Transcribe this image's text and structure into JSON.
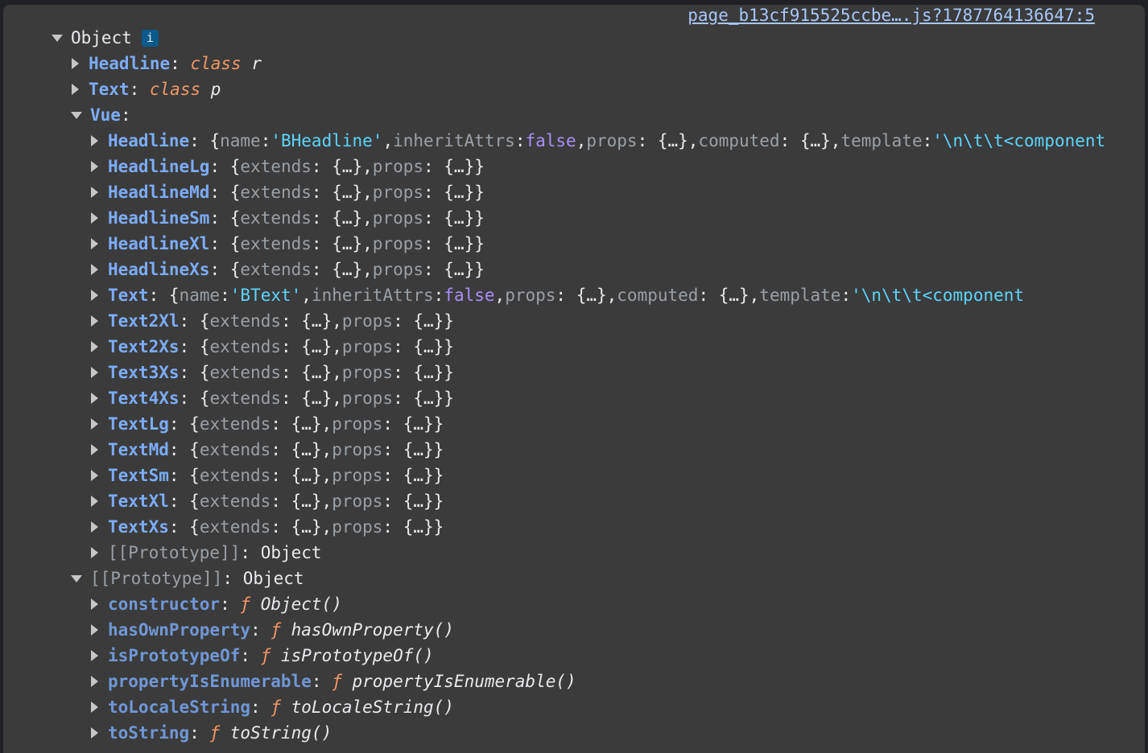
{
  "source_link": "page_b13cf915525ccbe….js?1787764136647:5",
  "root": {
    "label": "Object",
    "info_label": "i"
  },
  "colors": {
    "background": "#3b3b3b",
    "key": "#7cacf8",
    "string": "#5cd5fb",
    "boolean": "#a98ef7",
    "keyword": "#f29766",
    "muted": "#9aa0a6",
    "link": "#a8c7fa"
  },
  "icons": {
    "collapsed": "triangle-right-icon",
    "expanded": "triangle-down-icon",
    "info": "info-icon"
  },
  "rows": [
    {
      "depth": 1,
      "expanded": false,
      "key": "Headline",
      "kind": "class",
      "kw": "class",
      "name": "r"
    },
    {
      "depth": 1,
      "expanded": false,
      "key": "Text",
      "kind": "class",
      "kw": "class",
      "name": "p"
    },
    {
      "depth": 1,
      "expanded": true,
      "key": "Vue",
      "kind": "empty"
    },
    {
      "depth": 2,
      "expanded": false,
      "key": "Headline",
      "kind": "object",
      "parts": [
        {
          "t": "plain",
          "v": "{"
        },
        {
          "t": "pk",
          "v": "name"
        },
        {
          "t": "plain",
          "v": ": "
        },
        {
          "t": "str",
          "v": "'BHeadline'"
        },
        {
          "t": "plain",
          "v": ", "
        },
        {
          "t": "pk",
          "v": "inheritAttrs"
        },
        {
          "t": "plain",
          "v": ": "
        },
        {
          "t": "bool",
          "v": "false"
        },
        {
          "t": "plain",
          "v": ", "
        },
        {
          "t": "pk",
          "v": "props"
        },
        {
          "t": "plain",
          "v": ": {…}, "
        },
        {
          "t": "pk",
          "v": "computed"
        },
        {
          "t": "plain",
          "v": ": {…}, "
        },
        {
          "t": "pk",
          "v": "template"
        },
        {
          "t": "plain",
          "v": ": "
        },
        {
          "t": "str",
          "v": "'\\n\\t\\t<component"
        }
      ]
    },
    {
      "depth": 2,
      "expanded": false,
      "key": "HeadlineLg",
      "kind": "ext"
    },
    {
      "depth": 2,
      "expanded": false,
      "key": "HeadlineMd",
      "kind": "ext"
    },
    {
      "depth": 2,
      "expanded": false,
      "key": "HeadlineSm",
      "kind": "ext"
    },
    {
      "depth": 2,
      "expanded": false,
      "key": "HeadlineXl",
      "kind": "ext"
    },
    {
      "depth": 2,
      "expanded": false,
      "key": "HeadlineXs",
      "kind": "ext"
    },
    {
      "depth": 2,
      "expanded": false,
      "key": "Text",
      "kind": "object",
      "parts": [
        {
          "t": "plain",
          "v": "{"
        },
        {
          "t": "pk",
          "v": "name"
        },
        {
          "t": "plain",
          "v": ": "
        },
        {
          "t": "str",
          "v": "'BText'"
        },
        {
          "t": "plain",
          "v": ", "
        },
        {
          "t": "pk",
          "v": "inheritAttrs"
        },
        {
          "t": "plain",
          "v": ": "
        },
        {
          "t": "bool",
          "v": "false"
        },
        {
          "t": "plain",
          "v": ", "
        },
        {
          "t": "pk",
          "v": "props"
        },
        {
          "t": "plain",
          "v": ": {…}, "
        },
        {
          "t": "pk",
          "v": "computed"
        },
        {
          "t": "plain",
          "v": ": {…}, "
        },
        {
          "t": "pk",
          "v": "template"
        },
        {
          "t": "plain",
          "v": ": "
        },
        {
          "t": "str",
          "v": "'\\n\\t\\t<component"
        }
      ]
    },
    {
      "depth": 2,
      "expanded": false,
      "key": "Text2Xl",
      "kind": "ext"
    },
    {
      "depth": 2,
      "expanded": false,
      "key": "Text2Xs",
      "kind": "ext"
    },
    {
      "depth": 2,
      "expanded": false,
      "key": "Text3Xs",
      "kind": "ext"
    },
    {
      "depth": 2,
      "expanded": false,
      "key": "Text4Xs",
      "kind": "ext"
    },
    {
      "depth": 2,
      "expanded": false,
      "key": "TextLg",
      "kind": "ext"
    },
    {
      "depth": 2,
      "expanded": false,
      "key": "TextMd",
      "kind": "ext"
    },
    {
      "depth": 2,
      "expanded": false,
      "key": "TextSm",
      "kind": "ext"
    },
    {
      "depth": 2,
      "expanded": false,
      "key": "TextXl",
      "kind": "ext"
    },
    {
      "depth": 2,
      "expanded": false,
      "key": "TextXs",
      "kind": "ext"
    },
    {
      "depth": 2,
      "expanded": false,
      "key": "[[Prototype]]",
      "kind": "internal",
      "value": "Object"
    },
    {
      "depth": 1,
      "expanded": true,
      "key": "[[Prototype]]",
      "kind": "internal",
      "value": "Object"
    },
    {
      "depth": 2,
      "expanded": false,
      "key": "constructor",
      "kind": "func",
      "kw": "ƒ",
      "name": "Object()"
    },
    {
      "depth": 2,
      "expanded": false,
      "key": "hasOwnProperty",
      "kind": "func",
      "kw": "ƒ",
      "name": "hasOwnProperty()"
    },
    {
      "depth": 2,
      "expanded": false,
      "key": "isPrototypeOf",
      "kind": "func",
      "kw": "ƒ",
      "name": "isPrototypeOf()"
    },
    {
      "depth": 2,
      "expanded": false,
      "key": "propertyIsEnumerable",
      "kind": "func",
      "kw": "ƒ",
      "name": "propertyIsEnumerable()"
    },
    {
      "depth": 2,
      "expanded": false,
      "key": "toLocaleString",
      "kind": "func",
      "kw": "ƒ",
      "name": "toLocaleString()"
    },
    {
      "depth": 2,
      "expanded": false,
      "key": "toString",
      "kind": "func",
      "kw": "ƒ",
      "name": "toString()"
    }
  ],
  "ext_parts": [
    {
      "t": "plain",
      "v": "{"
    },
    {
      "t": "pk",
      "v": "extends"
    },
    {
      "t": "plain",
      "v": ": {…}, "
    },
    {
      "t": "pk",
      "v": "props"
    },
    {
      "t": "plain",
      "v": ": {…}}"
    }
  ]
}
